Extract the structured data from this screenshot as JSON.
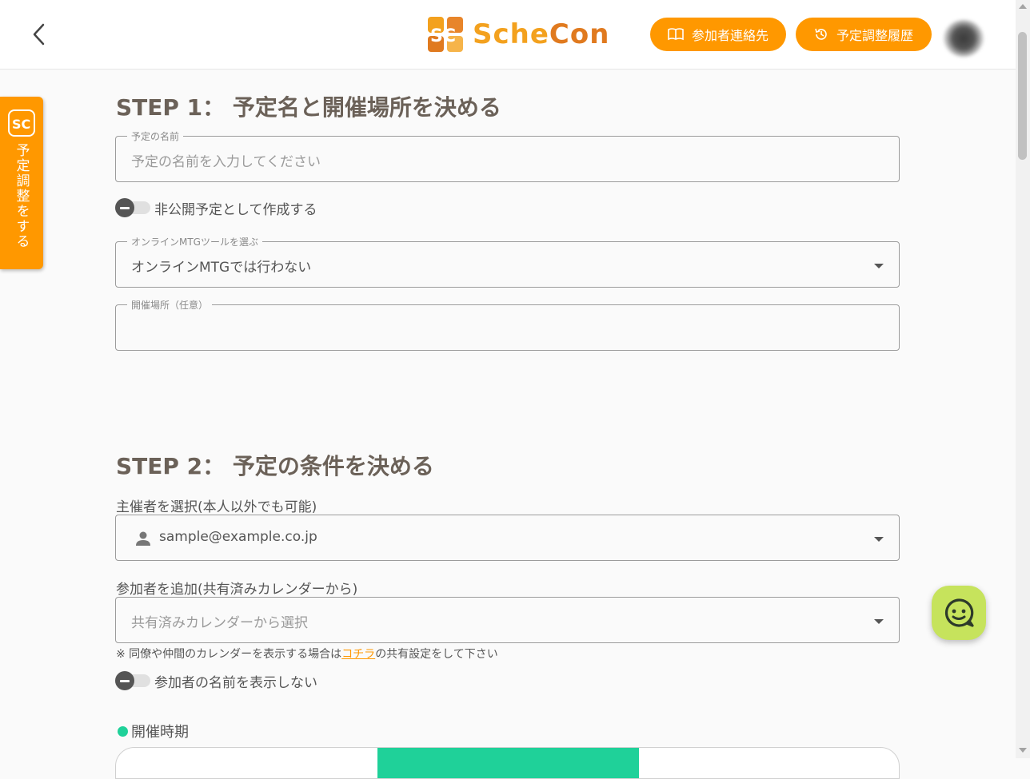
{
  "header": {
    "logo_text_1": "Sche",
    "logo_text_2": "Con",
    "contacts_button": "参加者連絡先",
    "history_button": "予定調整履歴"
  },
  "side_tab": {
    "label": "予定調整をする"
  },
  "step1": {
    "title": "STEP 1： 予定名と開催場所を決める",
    "event_name": {
      "label": "予定の名前",
      "placeholder": "予定の名前を入力してください"
    },
    "private_toggle": {
      "label": "非公開予定として作成する",
      "checked": false
    },
    "online_tool": {
      "label": "オンラインMTGツールを選ぶ",
      "value": "オンラインMTGでは行わない"
    },
    "venue": {
      "label": "開催場所（任意）",
      "value": ""
    }
  },
  "step2": {
    "title": "STEP 2： 予定の条件を決める",
    "organizer": {
      "label": "主催者を選択(本人以外でも可能)",
      "value": "sample@example.co.jp"
    },
    "participants": {
      "label": "参加者を追加(共有済みカレンダーから)",
      "placeholder": "共有済みカレンダーから選択"
    },
    "note_prefix": "※ 同僚や仲間のカレンダーを表示する場合は",
    "note_link": "コチラ",
    "note_suffix": "の共有設定をして下さい",
    "hide_names_toggle": {
      "label": "参加者の名前を表示しない",
      "checked": false
    },
    "period_title": "開催時期"
  },
  "colors": {
    "accent": "#ff9800",
    "step_title": "#6b6158",
    "green": "#1fd199",
    "chat": "#c6e35c"
  }
}
